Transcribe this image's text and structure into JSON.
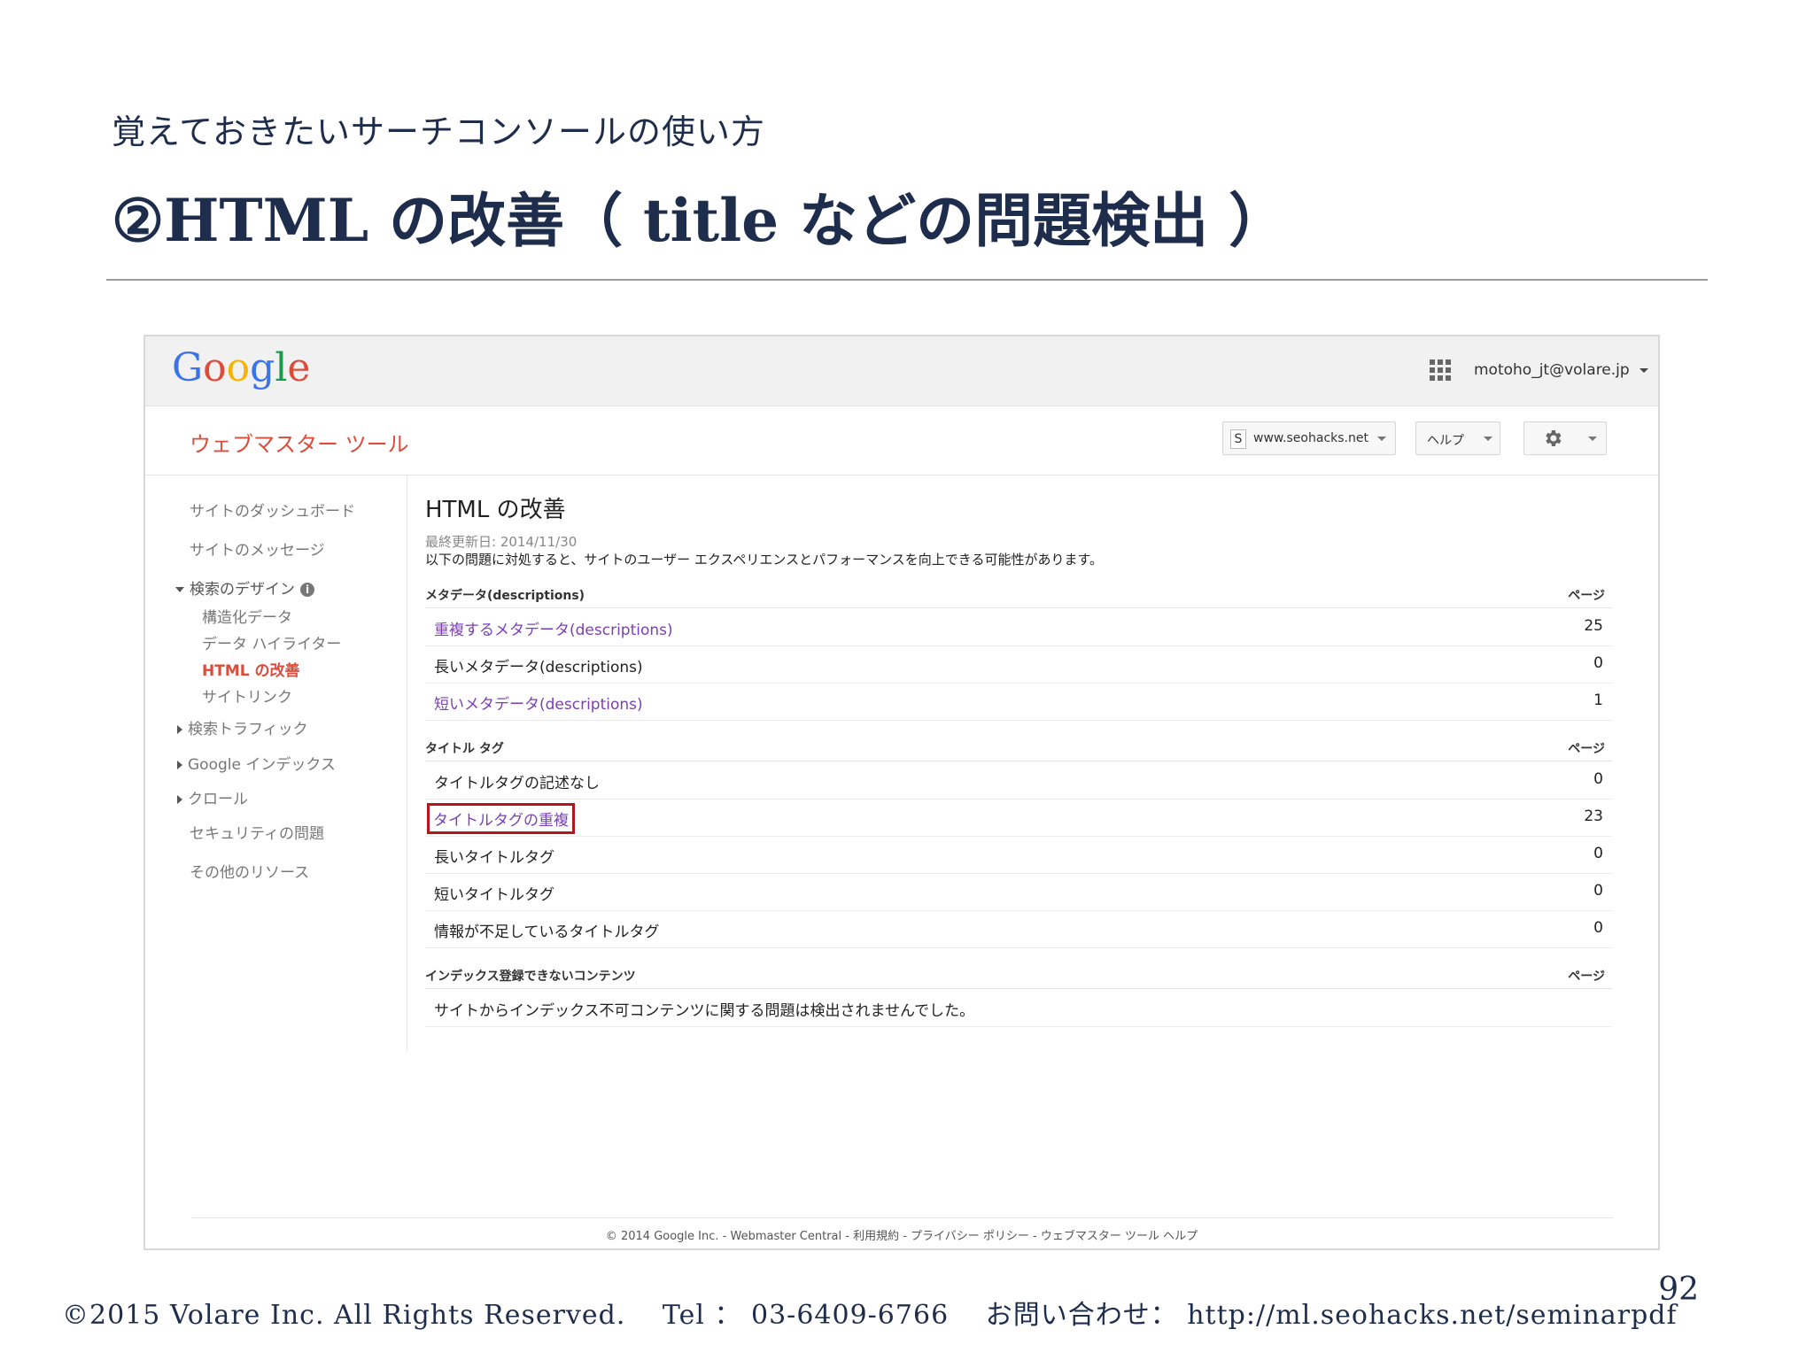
{
  "slide": {
    "subtitle": "覚えておきたいサーチコンソールの使い方",
    "title": "②HTML の改善（ title などの問題検出 ）",
    "page_number": "92",
    "footer": "©2015 Volare Inc. All Rights Reserved.　 Tel ： 03-6409-6766　 お問い合わせ： http://ml.seohacks.net/seminarpdf"
  },
  "google": {
    "logo_letters": [
      "G",
      "o",
      "o",
      "g",
      "l",
      "e"
    ],
    "logo_colors": [
      "#3b73e8",
      "#dd4b39",
      "#f4b400",
      "#3b73e8",
      "#1a9b4c",
      "#dd4b39"
    ],
    "account": "motoho_jt@volare.jp",
    "app_title": "ウェブマスター ツール",
    "site_label": "www.seohacks.net",
    "site_icon": "S",
    "help_label": "ヘルプ"
  },
  "sidebar": {
    "items": [
      {
        "label": "サイトのダッシュボード"
      },
      {
        "label": "サイトのメッセージ"
      },
      {
        "label": "検索のデザイン"
      },
      {
        "label": "構造化データ"
      },
      {
        "label": "データ ハイライター"
      },
      {
        "label": "HTML の改善"
      },
      {
        "label": "サイトリンク"
      },
      {
        "label": "検索トラフィック"
      },
      {
        "label": "Google インデックス"
      },
      {
        "label": "クロール"
      },
      {
        "label": "セキュリティの問題"
      },
      {
        "label": "その他のリソース"
      }
    ]
  },
  "main": {
    "heading": "HTML の改善",
    "last_updated": "最終更新日: 2014/11/30",
    "description": "以下の問題に対処すると、サイトのユーザー エクスペリエンスとパフォーマンスを向上できる可能性があります。",
    "sections": [
      {
        "title": "メタデータ(descriptions)",
        "page_header": "ページ",
        "rows": [
          {
            "label": "重複するメタデータ(descriptions)",
            "count": "25"
          },
          {
            "label": "長いメタデータ(descriptions)",
            "count": "0"
          },
          {
            "label": "短いメタデータ(descriptions)",
            "count": "1"
          }
        ]
      },
      {
        "title": "タイトル タグ",
        "page_header": "ページ",
        "rows": [
          {
            "label": "タイトルタグの記述なし",
            "count": "0"
          },
          {
            "label": "タイトルタグの重複",
            "count": "23"
          },
          {
            "label": "長いタイトルタグ",
            "count": "0"
          },
          {
            "label": "短いタイトルタグ",
            "count": "0"
          },
          {
            "label": "情報が不足しているタイトルタグ",
            "count": "0"
          }
        ]
      },
      {
        "title": "インデックス登録できないコンテンツ",
        "page_header": "ページ",
        "message": "サイトからインデックス不可コンテンツに関する問題は検出されませんでした。"
      }
    ]
  },
  "footer_text": "© 2014 Google Inc. - Webmaster Central - 利用規約 - プライバシー ポリシー - ウェブマスター ツール ヘルプ",
  "colors": {
    "google_red": "#dd4b39",
    "link_purple": "#7b3fb5",
    "highlight_border": "#b3161b",
    "slide_text": "#1f2d4d"
  }
}
